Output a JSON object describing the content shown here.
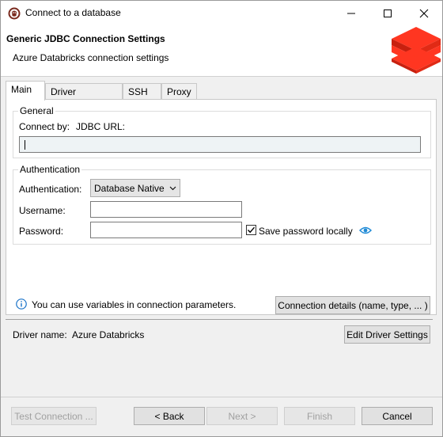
{
  "window": {
    "title": "Connect to a database"
  },
  "banner": {
    "title": "Generic JDBC Connection Settings",
    "subtitle": "Azure Databricks connection settings"
  },
  "tabs": [
    {
      "label": "Main",
      "active": true
    },
    {
      "label": "Driver properties",
      "active": false
    },
    {
      "label": "SSH",
      "active": false
    },
    {
      "label": "Proxy",
      "active": false
    }
  ],
  "general": {
    "legend": "General",
    "connect_by_label": "Connect by:",
    "connect_by_value": "JDBC URL:",
    "jdbc_url_value": ""
  },
  "auth": {
    "legend": "Authentication",
    "auth_label": "Authentication:",
    "auth_value": "Database Native",
    "username_label": "Username:",
    "username_value": "",
    "password_label": "Password:",
    "password_value": "",
    "save_password_label": "Save password locally",
    "save_password_checked": true
  },
  "info": {
    "text": "You can use variables in connection parameters.",
    "details_button": "Connection details (name, type, ... )"
  },
  "driver": {
    "label": "Driver name:",
    "value": "Azure Databricks",
    "edit_button": "Edit Driver Settings"
  },
  "footer": {
    "test_button": "Test Connection ...",
    "back_button": "< Back",
    "next_button": "Next >",
    "finish_button": "Finish",
    "cancel_button": "Cancel"
  },
  "colors": {
    "accent": "#ff3621",
    "info_blue": "#1a73c9",
    "eye_blue": "#1f8ad6"
  },
  "icons": {
    "app": "dbeaver-beaver-icon",
    "logo": "databricks-logo",
    "minimize": "minimize-icon",
    "maximize": "maximize-icon",
    "close": "close-icon",
    "dropdown": "chevron-down-icon",
    "info": "info-icon",
    "eye": "eye-icon"
  }
}
